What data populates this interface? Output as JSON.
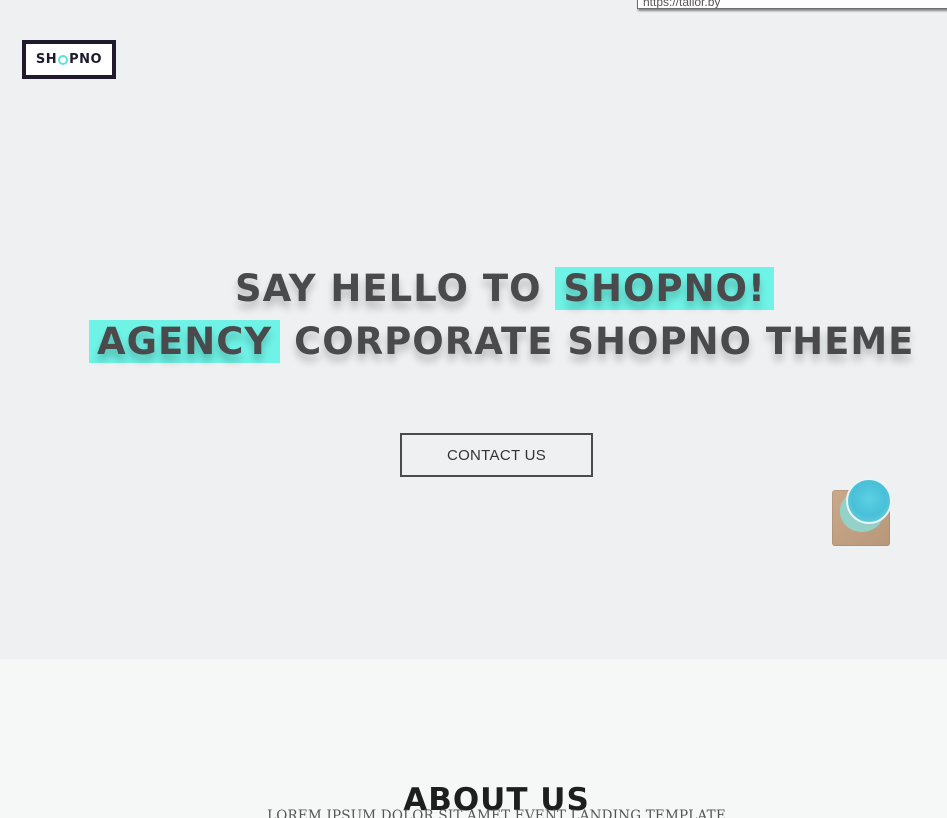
{
  "browser": {
    "url_fragment": "https://tailor.by"
  },
  "header": {
    "logo_prefix": "SH",
    "logo_suffix": "PNO"
  },
  "hero": {
    "line1_plain": "SAY HELLO TO ",
    "line1_highlight": "SHOPNO!",
    "line2_highlight": "AGENCY",
    "line2_plain": " CORPORATE SHOPNO THEME",
    "cta_label": "CONTACT US",
    "highlight_color": "#6ff3e6",
    "text_color": "#4a4a4c"
  },
  "chat_widget": {
    "icon": "chat-avatar-icon"
  },
  "about": {
    "title": "ABOUT US",
    "subtitle": "LOREM IPSUM DOLOR SIT AMET EVENT LANDING TEMPLATE"
  }
}
